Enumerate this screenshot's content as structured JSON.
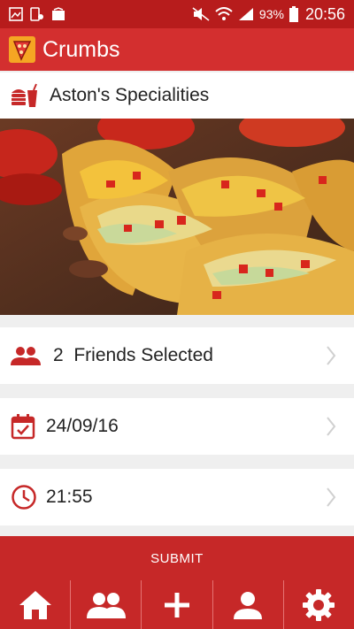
{
  "status_bar": {
    "battery": "93%",
    "time": "20:56"
  },
  "app": {
    "title": "Crumbs"
  },
  "venue": {
    "name": "Aston's Specialities"
  },
  "form": {
    "friends_count": "2",
    "friends_label": "Friends Selected",
    "date": "24/09/16",
    "time": "21:55"
  },
  "submit": {
    "label": "SUBMIT"
  },
  "tabs": [
    {
      "icon": "home-icon"
    },
    {
      "icon": "group-icon"
    },
    {
      "icon": "plus-icon"
    },
    {
      "icon": "person-icon"
    },
    {
      "icon": "gear-icon"
    }
  ],
  "colors": {
    "status_bar": "#b71c1c",
    "app_bar": "#d32f2f",
    "accent": "#c62828",
    "background": "#efefef"
  }
}
